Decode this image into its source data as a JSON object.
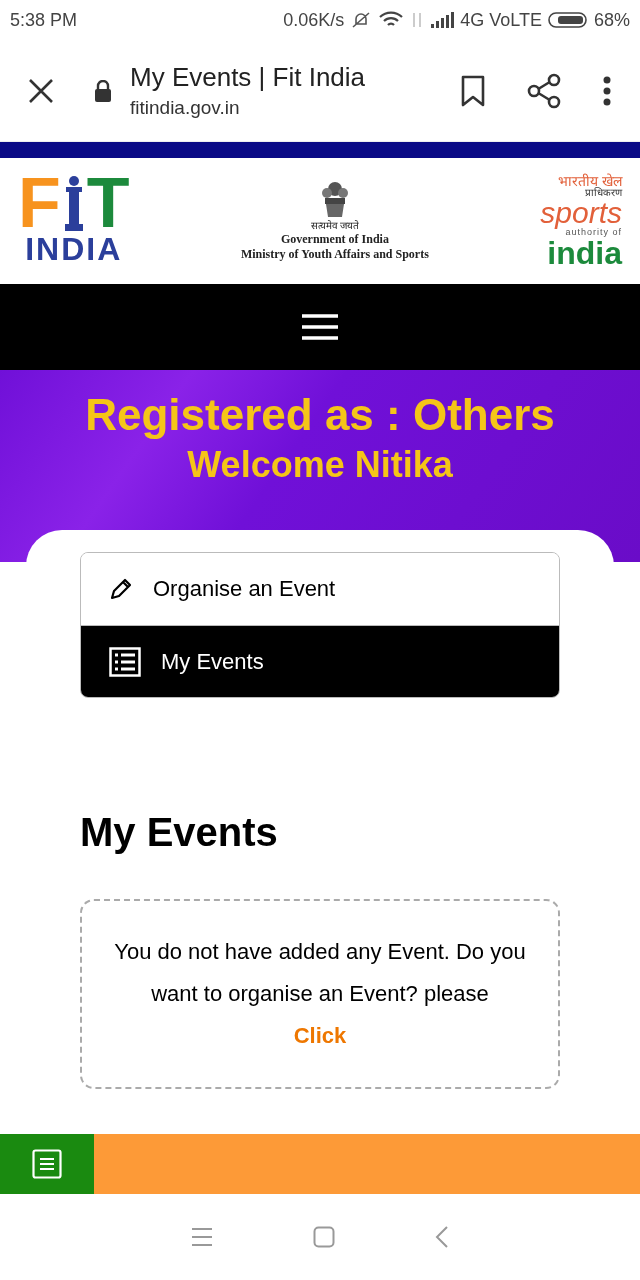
{
  "status_bar": {
    "time": "5:38 PM",
    "speed": "0.06K/s",
    "network": "4G VoLTE",
    "battery": "68%"
  },
  "browser": {
    "title": "My Events | Fit India",
    "url": "fitindia.gov.in"
  },
  "header": {
    "fit_logo": {
      "letters": [
        "F",
        "T"
      ],
      "word": "INDIA"
    },
    "emblem_motto": "सत्यमेव जयते",
    "government": "Government of India",
    "ministry": "Ministry of Youth Affairs and Sports",
    "sai_logo": {
      "hindi": "भारतीय खेल",
      "hindi_sub": "प्राधिकरण",
      "sports": "sports",
      "authority": "authority of",
      "india": "india"
    }
  },
  "banner": {
    "registered": "Registered as : Others",
    "welcome": "Welcome Nitika"
  },
  "menu": [
    {
      "kind": "pencil",
      "label": "Organise an Event",
      "selected": false
    },
    {
      "kind": "list",
      "label": "My Events",
      "selected": true
    }
  ],
  "section": {
    "heading": "My Events",
    "message": "You do not have added any Event. Do you want to organise an Event? please",
    "link": "Click"
  }
}
